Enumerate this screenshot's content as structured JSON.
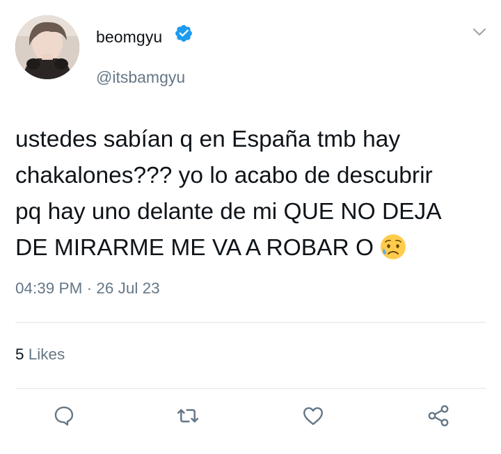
{
  "author": {
    "display_name": "beomgyu",
    "handle": "@itsbamgyu",
    "verified": true
  },
  "tweet": {
    "text": "ustedes sabían q en España tmb hay\nchakalones??? yo lo acabo de descubrir\npq hay uno delante de mi QUE NO DEJA\nDE MIRARME ME VA A ROBAR O",
    "emoji": "sad-but-relieved-face"
  },
  "meta": {
    "time": "04:39 PM",
    "separator": "·",
    "date": "26 Jul 23"
  },
  "stats": {
    "likes_count": "5",
    "likes_label": "Likes"
  },
  "actions": {
    "reply": "reply-icon",
    "retweet": "retweet-icon",
    "like": "heart-icon",
    "share": "share-icon"
  },
  "colors": {
    "text": "#0f1419",
    "secondary": "#657786",
    "verified": "#1d9bf0",
    "divider": "#dfe3e6"
  }
}
